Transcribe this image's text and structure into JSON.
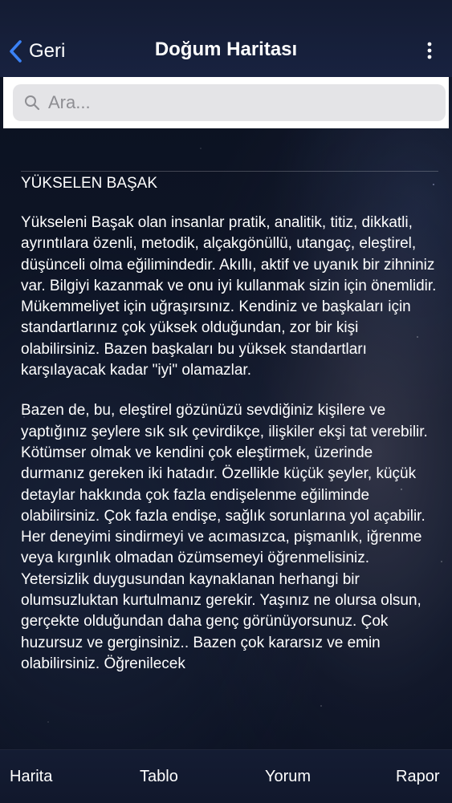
{
  "header": {
    "back_label": "Geri",
    "title": "Doğum Haritası"
  },
  "search": {
    "placeholder": "Ara..."
  },
  "content": {
    "section_title": "YÜKSELEN BAŞAK",
    "paragraphs": [
      "Yükseleni Başak olan insanlar pratik, analitik, titiz, dikkatli, ayrıntılara özenli, metodik, alçakgönüllü, utangaç, eleştirel, düşünceli olma eğilimindedir. Akıllı, aktif ve uyanık bir zihniniz var. Bilgiyi kazanmak ve onu iyi kullanmak sizin için önemlidir. Mükemmeliyet için uğraşırsınız. Kendiniz ve başkaları için standartlarınız çok yüksek olduğundan, zor bir kişi olabilirsiniz. Bazen başkaları bu yüksek standartları karşılayacak kadar \"iyi\" olamazlar.",
      "Bazen de, bu, eleştirel gözünüzü sevdiğiniz kişilere ve yaptığınız şeylere sık sık çevirdikçe, ilişkiler ekşi tat verebilir. Kötümser olmak ve kendini çok eleştirmek, üzerinde durmanız gereken iki hatadır. Özellikle küçük şeyler, küçük detaylar hakkında çok fazla endişelenme eğiliminde olabilirsiniz. Çok fazla endişe, sağlık sorunlarına yol açabilir. Her deneyimi sindirmeyi ve acımasızca, pişmanlık, iğrenme veya kırgınlık olmadan özümsemeyi öğrenmelisiniz. Yetersizlik duygusundan kaynaklanan herhangi bir olumsuzluktan kurtulmanız gerekir. Yaşınız ne olursa olsun, gerçekte olduğundan daha genç görünüyorsunuz. Çok huzursuz ve gerginsiniz.. Bazen çok kararsız ve emin olabilirsiniz. Öğrenilecek"
    ]
  },
  "tabbar": {
    "tabs": [
      {
        "label": "Harita"
      },
      {
        "label": "Tablo"
      },
      {
        "label": "Yorum"
      },
      {
        "label": "Rapor"
      }
    ]
  },
  "colors": {
    "accent": "#3b82f6",
    "background": "#0e1526",
    "navbar": "#182240",
    "text": "#ffffff"
  },
  "icons": [
    "chevron-left-icon",
    "more-vertical-icon",
    "search-icon"
  ]
}
